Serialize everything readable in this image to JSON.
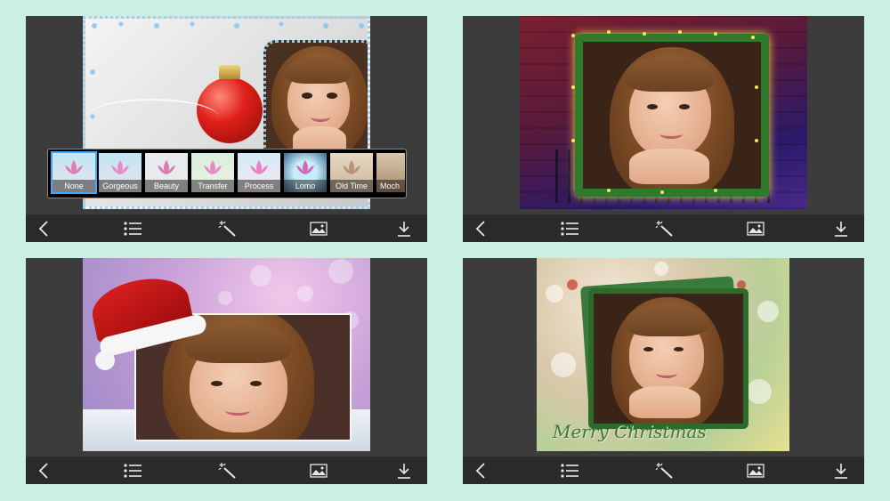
{
  "colors": {
    "background": "#c9f0e1",
    "phone_frame": "#3c3c3c",
    "toolbar": "#2a2a2a",
    "toolbar_icon": "#e8e8e8",
    "selected_filter": "#3fa8ff"
  },
  "toolbar": {
    "icons": [
      "back-chevron-icon",
      "list-icon",
      "magic-wand-icon",
      "image-icon",
      "download-icon"
    ]
  },
  "screens": [
    {
      "filters": [
        {
          "label": "None",
          "selected": true
        },
        {
          "label": "Gorgeous",
          "selected": false
        },
        {
          "label": "Beauty",
          "selected": false
        },
        {
          "label": "Transfer",
          "selected": false
        },
        {
          "label": "Process",
          "selected": false
        },
        {
          "label": "Lomo",
          "selected": false
        },
        {
          "label": "Old Time",
          "selected": false
        },
        {
          "label": "Moch",
          "selected": false
        }
      ]
    },
    {},
    {},
    {
      "frame_text": "Merry Christmas"
    }
  ]
}
